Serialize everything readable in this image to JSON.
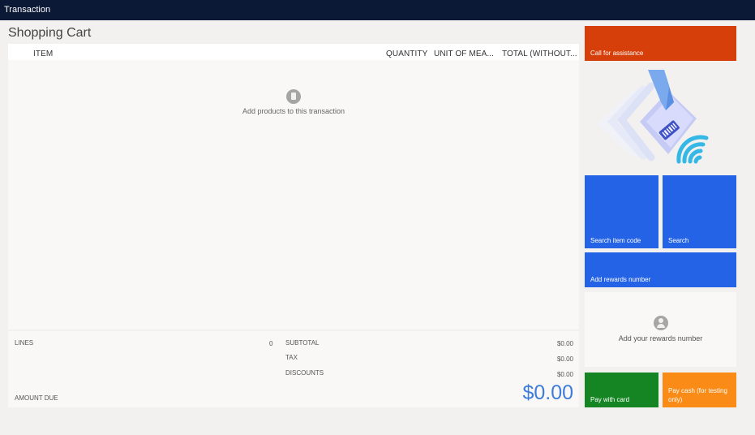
{
  "window": {
    "title": "Transaction"
  },
  "cart": {
    "title": "Shopping Cart",
    "columns": {
      "item": "ITEM",
      "quantity": "QUANTITY",
      "unit_of_measure": "UNIT OF MEA...",
      "total": "TOTAL (WITHOUT..."
    },
    "empty_message": "Add products to this transaction"
  },
  "totals": {
    "lines_label": "LINES",
    "lines_value": "0",
    "subtotal_label": "SUBTOTAL",
    "subtotal_value": "$0.00",
    "tax_label": "TAX",
    "tax_value": "$0.00",
    "discounts_label": "DISCOUNTS",
    "discounts_value": "$0.00",
    "amount_due_label": "AMOUNT DUE",
    "amount_due_value": "$0.00"
  },
  "actions": {
    "assistance": "Call for assistance",
    "search_item_code": "Search item code",
    "search": "Search",
    "add_rewards": "Add rewards number",
    "pay_card": "Pay with card",
    "pay_cash": "Pay cash (for testing only)"
  },
  "rewards_panel": {
    "message": "Add your rewards number"
  },
  "icons": {
    "empty_cart": "product-icon",
    "rewards": "person-icon",
    "illustration": "scan-barcode-illustration"
  },
  "colors": {
    "titlebar": "#0b1836",
    "assist": "#d63f09",
    "primary": "#2563e6",
    "pay_card": "#148522",
    "pay_cash": "#f98b16",
    "amount_due": "#3f7bd9"
  }
}
